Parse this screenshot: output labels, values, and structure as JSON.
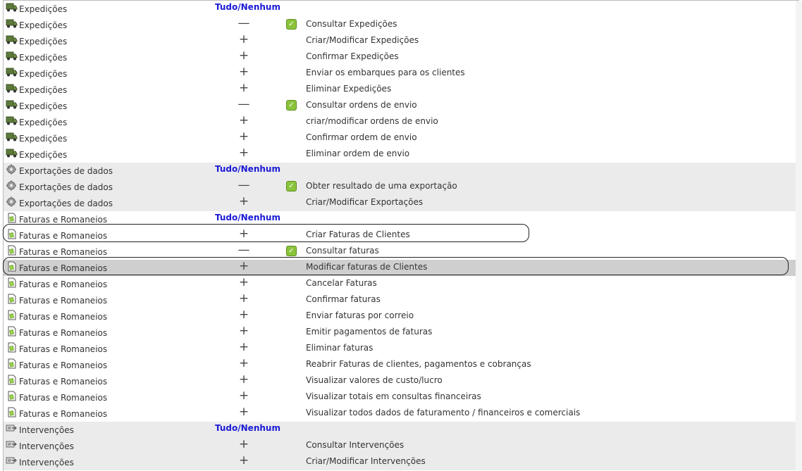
{
  "tudo_nenhum": {
    "tudo": "Tudo",
    "sep": "/",
    "nenhum": "Nenhum"
  },
  "rows": [
    {
      "module": "Expedições",
      "icon": "truck-icon",
      "type": "header",
      "bg": "white"
    },
    {
      "module": "Expedições",
      "icon": "truck-icon",
      "toggle": "—",
      "checked": true,
      "label": "Consultar Expedições",
      "bg": "white"
    },
    {
      "module": "Expedições",
      "icon": "truck-icon",
      "toggle": "+",
      "checked": false,
      "label": "Criar/Modificar Expedições",
      "bg": "white"
    },
    {
      "module": "Expedições",
      "icon": "truck-icon",
      "toggle": "+",
      "checked": false,
      "label": "Confirmar Expedições",
      "bg": "white"
    },
    {
      "module": "Expedições",
      "icon": "truck-icon",
      "toggle": "+",
      "checked": false,
      "label": "Enviar os embarques para os clientes",
      "bg": "white"
    },
    {
      "module": "Expedições",
      "icon": "truck-icon",
      "toggle": "+",
      "checked": false,
      "label": "Eliminar Expedições",
      "bg": "white"
    },
    {
      "module": "Expedições",
      "icon": "truck-icon",
      "toggle": "—",
      "checked": true,
      "label": "Consultar ordens de envio",
      "bg": "white"
    },
    {
      "module": "Expedições",
      "icon": "truck-icon",
      "toggle": "+",
      "checked": false,
      "label": "criar/modificar ordens de envio",
      "bg": "white"
    },
    {
      "module": "Expedições",
      "icon": "truck-icon",
      "toggle": "+",
      "checked": false,
      "label": "Confirmar ordem de envio",
      "bg": "white"
    },
    {
      "module": "Expedições",
      "icon": "truck-icon",
      "toggle": "+",
      "checked": false,
      "label": "Eliminar ordem de envio",
      "bg": "white"
    },
    {
      "module": "Exportações de dados",
      "icon": "gear-icon",
      "type": "header",
      "bg": "grey"
    },
    {
      "module": "Exportações de dados",
      "icon": "gear-icon",
      "toggle": "—",
      "checked": true,
      "label": "Obter resultado de uma exportação",
      "bg": "grey"
    },
    {
      "module": "Exportações de dados",
      "icon": "gear-icon",
      "toggle": "+",
      "checked": false,
      "label": "Criar/Modificar Exportações",
      "bg": "grey"
    },
    {
      "module": "Faturas e Romaneios",
      "icon": "invoice-icon",
      "type": "header",
      "bg": "white"
    },
    {
      "module": "Faturas e Romaneios",
      "icon": "invoice-icon",
      "toggle": "+",
      "checked": false,
      "label": "Criar Faturas de Clientes",
      "bg": "white"
    },
    {
      "module": "Faturas e Romaneios",
      "icon": "invoice-icon",
      "toggle": "—",
      "checked": true,
      "label": "Consultar faturas",
      "bg": "white"
    },
    {
      "module": "Faturas e Romaneios",
      "icon": "invoice-icon",
      "toggle": "+",
      "checked": false,
      "label": "Modificar faturas de Clientes",
      "bg": "sel"
    },
    {
      "module": "Faturas e Romaneios",
      "icon": "invoice-icon",
      "toggle": "+",
      "checked": false,
      "label": "Cancelar Faturas",
      "bg": "white"
    },
    {
      "module": "Faturas e Romaneios",
      "icon": "invoice-icon",
      "toggle": "+",
      "checked": false,
      "label": "Confirmar faturas",
      "bg": "white"
    },
    {
      "module": "Faturas e Romaneios",
      "icon": "invoice-icon",
      "toggle": "+",
      "checked": false,
      "label": "Enviar faturas por correio",
      "bg": "white"
    },
    {
      "module": "Faturas e Romaneios",
      "icon": "invoice-icon",
      "toggle": "+",
      "checked": false,
      "label": "Emitir pagamentos de faturas",
      "bg": "white"
    },
    {
      "module": "Faturas e Romaneios",
      "icon": "invoice-icon",
      "toggle": "+",
      "checked": false,
      "label": "Eliminar faturas",
      "bg": "white"
    },
    {
      "module": "Faturas e Romaneios",
      "icon": "invoice-icon",
      "toggle": "+",
      "checked": false,
      "label": "Reabrir Faturas de clientes, pagamentos e cobranças",
      "bg": "white"
    },
    {
      "module": "Faturas e Romaneios",
      "icon": "invoice-icon",
      "toggle": "+",
      "checked": false,
      "label": "Visualizar valores de custo/lucro",
      "bg": "white"
    },
    {
      "module": "Faturas e Romaneios",
      "icon": "invoice-icon",
      "toggle": "+",
      "checked": false,
      "label": "Visualizar totais em consultas financeiras",
      "bg": "white"
    },
    {
      "module": "Faturas e Romaneios",
      "icon": "invoice-icon",
      "toggle": "+",
      "checked": false,
      "label": "Visualizar todos dados de faturamento / financeiros e comerciais",
      "bg": "white"
    },
    {
      "module": "Intervenções",
      "icon": "intervention-icon",
      "type": "header",
      "bg": "grey"
    },
    {
      "module": "Intervenções",
      "icon": "intervention-icon",
      "toggle": "+",
      "checked": false,
      "label": "Consultar Intervenções",
      "bg": "grey"
    },
    {
      "module": "Intervenções",
      "icon": "intervention-icon",
      "toggle": "+",
      "checked": false,
      "label": "Criar/Modificar Intervenções",
      "bg": "grey"
    }
  ],
  "colors": {
    "link": "#1a1ad6",
    "check": "#8ac43b",
    "grey_row": "#ebebeb",
    "selected_row": "#cfcfcf"
  }
}
